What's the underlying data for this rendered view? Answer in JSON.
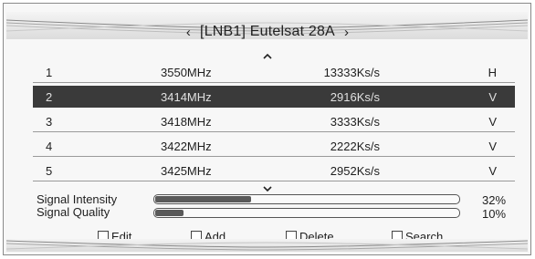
{
  "header": {
    "prev_icon": "chevron-left-icon",
    "title": "[LNB1] Eutelsat 28A",
    "next_icon": "chevron-right-icon"
  },
  "list": {
    "scroll_up_icon": "chevron-up-icon",
    "scroll_down_icon": "chevron-down-icon",
    "selected_index": 1,
    "rows": [
      {
        "no": "1",
        "freq": "3550MHz",
        "symbol_rate": "13333Ks/s",
        "pol": "H"
      },
      {
        "no": "2",
        "freq": "3414MHz",
        "symbol_rate": "2916Ks/s",
        "pol": "V"
      },
      {
        "no": "3",
        "freq": "3418MHz",
        "symbol_rate": "3333Ks/s",
        "pol": "V"
      },
      {
        "no": "4",
        "freq": "3422MHz",
        "symbol_rate": "2222Ks/s",
        "pol": "V"
      },
      {
        "no": "5",
        "freq": "3425MHz",
        "symbol_rate": "2952Ks/s",
        "pol": "V"
      }
    ]
  },
  "signal": {
    "intensity": {
      "label": "Signal Intensity",
      "value": 32,
      "text": "32%"
    },
    "quality": {
      "label": "Signal Quality",
      "value": 10,
      "text": "10%"
    }
  },
  "actions": {
    "edit": "Edit",
    "add": "Add",
    "delete": "Delete",
    "search": "Search"
  },
  "colors": {
    "selected_row_bg": "#3a3a3a",
    "meter_fill": "#5a5a5a"
  }
}
